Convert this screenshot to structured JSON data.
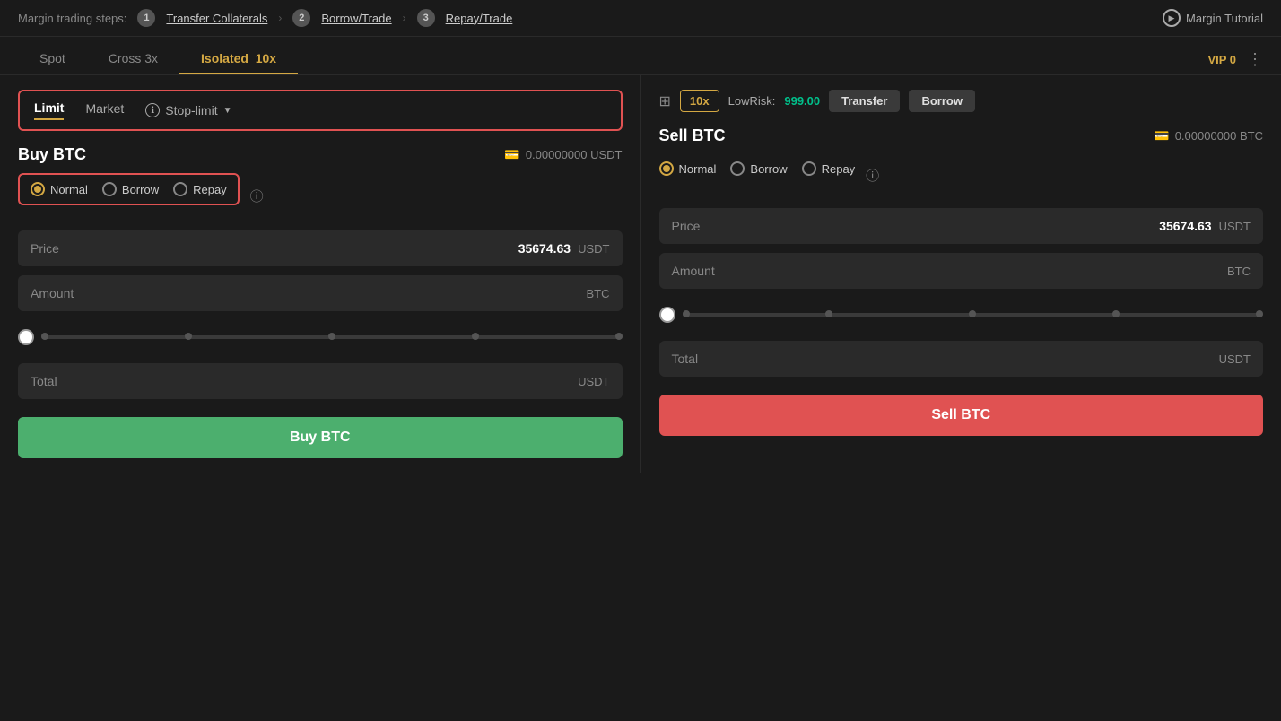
{
  "margin_steps": {
    "label": "Margin trading steps:",
    "step1_num": "1",
    "step1_link": "Transfer Collaterals",
    "step2_num": "2",
    "step2_link": "Borrow/Trade",
    "step3_num": "3",
    "step3_link": "Repay/Trade",
    "tutorial_label": "Margin Tutorial"
  },
  "tabs": {
    "spot": "Spot",
    "cross": "Cross 3x",
    "isolated": "Isolated",
    "isolated_leverage": "10x",
    "vip": "VIP 0"
  },
  "leverage_bar": {
    "leverage_value": "10x",
    "low_risk_label": "LowRisk:",
    "low_risk_value": "999.00",
    "transfer_btn": "Transfer",
    "borrow_btn": "Borrow"
  },
  "order_types": {
    "limit": "Limit",
    "market": "Market",
    "stop_limit": "Stop-limit"
  },
  "buy_panel": {
    "title": "Buy BTC",
    "balance": "0.00000000 USDT",
    "radio_normal": "Normal",
    "radio_borrow": "Borrow",
    "radio_repay": "Repay",
    "price_label": "Price",
    "price_value": "35674.63",
    "price_unit": "USDT",
    "amount_label": "Amount",
    "amount_unit": "BTC",
    "total_label": "Total",
    "total_unit": "USDT",
    "buy_btn": "Buy BTC"
  },
  "sell_panel": {
    "title": "Sell BTC",
    "balance": "0.00000000 BTC",
    "radio_normal": "Normal",
    "radio_borrow": "Borrow",
    "radio_repay": "Repay",
    "price_label": "Price",
    "price_value": "35674.63",
    "price_unit": "USDT",
    "amount_label": "Amount",
    "amount_unit": "BTC",
    "total_label": "Total",
    "total_unit": "USDT",
    "sell_btn": "Sell BTC"
  },
  "colors": {
    "accent_gold": "#d4a843",
    "buy_green": "#4caf6e",
    "sell_red": "#e05252",
    "low_risk_green": "#00c08b",
    "bg_dark": "#1a1a1a",
    "bg_input": "#2a2a2a"
  }
}
